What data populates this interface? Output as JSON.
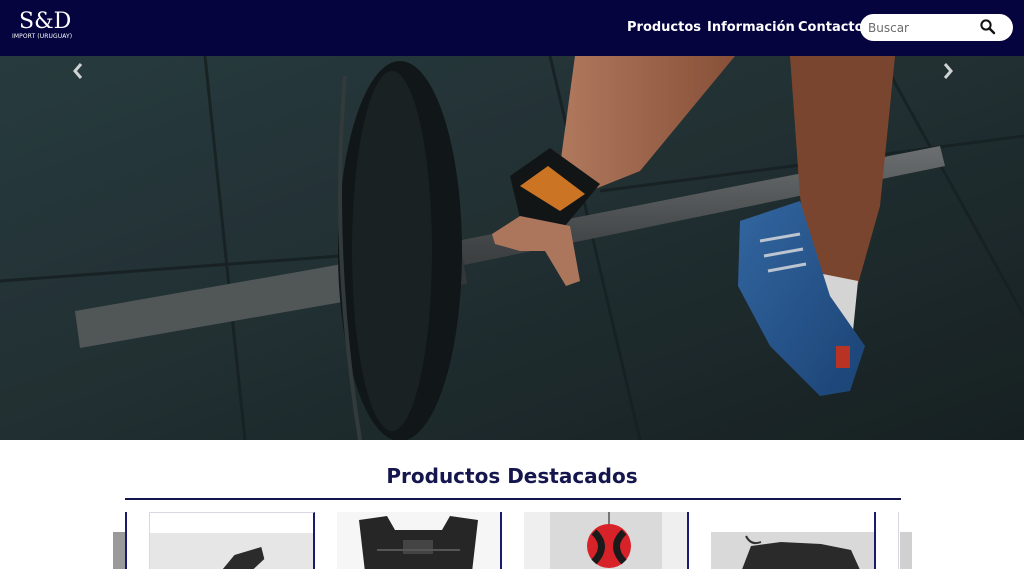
{
  "brand": {
    "name": "S&D",
    "subtitle": "IMPORT (URUGUAY)"
  },
  "nav": {
    "items": [
      {
        "label": "Productos"
      },
      {
        "label": "Información"
      },
      {
        "label": "Contacto"
      }
    ]
  },
  "search": {
    "placeholder": "Buscar"
  },
  "featured": {
    "title": "Productos Destacados"
  },
  "colors": {
    "navbar": "#05043f",
    "accent": "#16164f"
  },
  "icons": {
    "search": "search-icon",
    "prev": "chevron-left-icon",
    "next": "chevron-right-icon"
  }
}
